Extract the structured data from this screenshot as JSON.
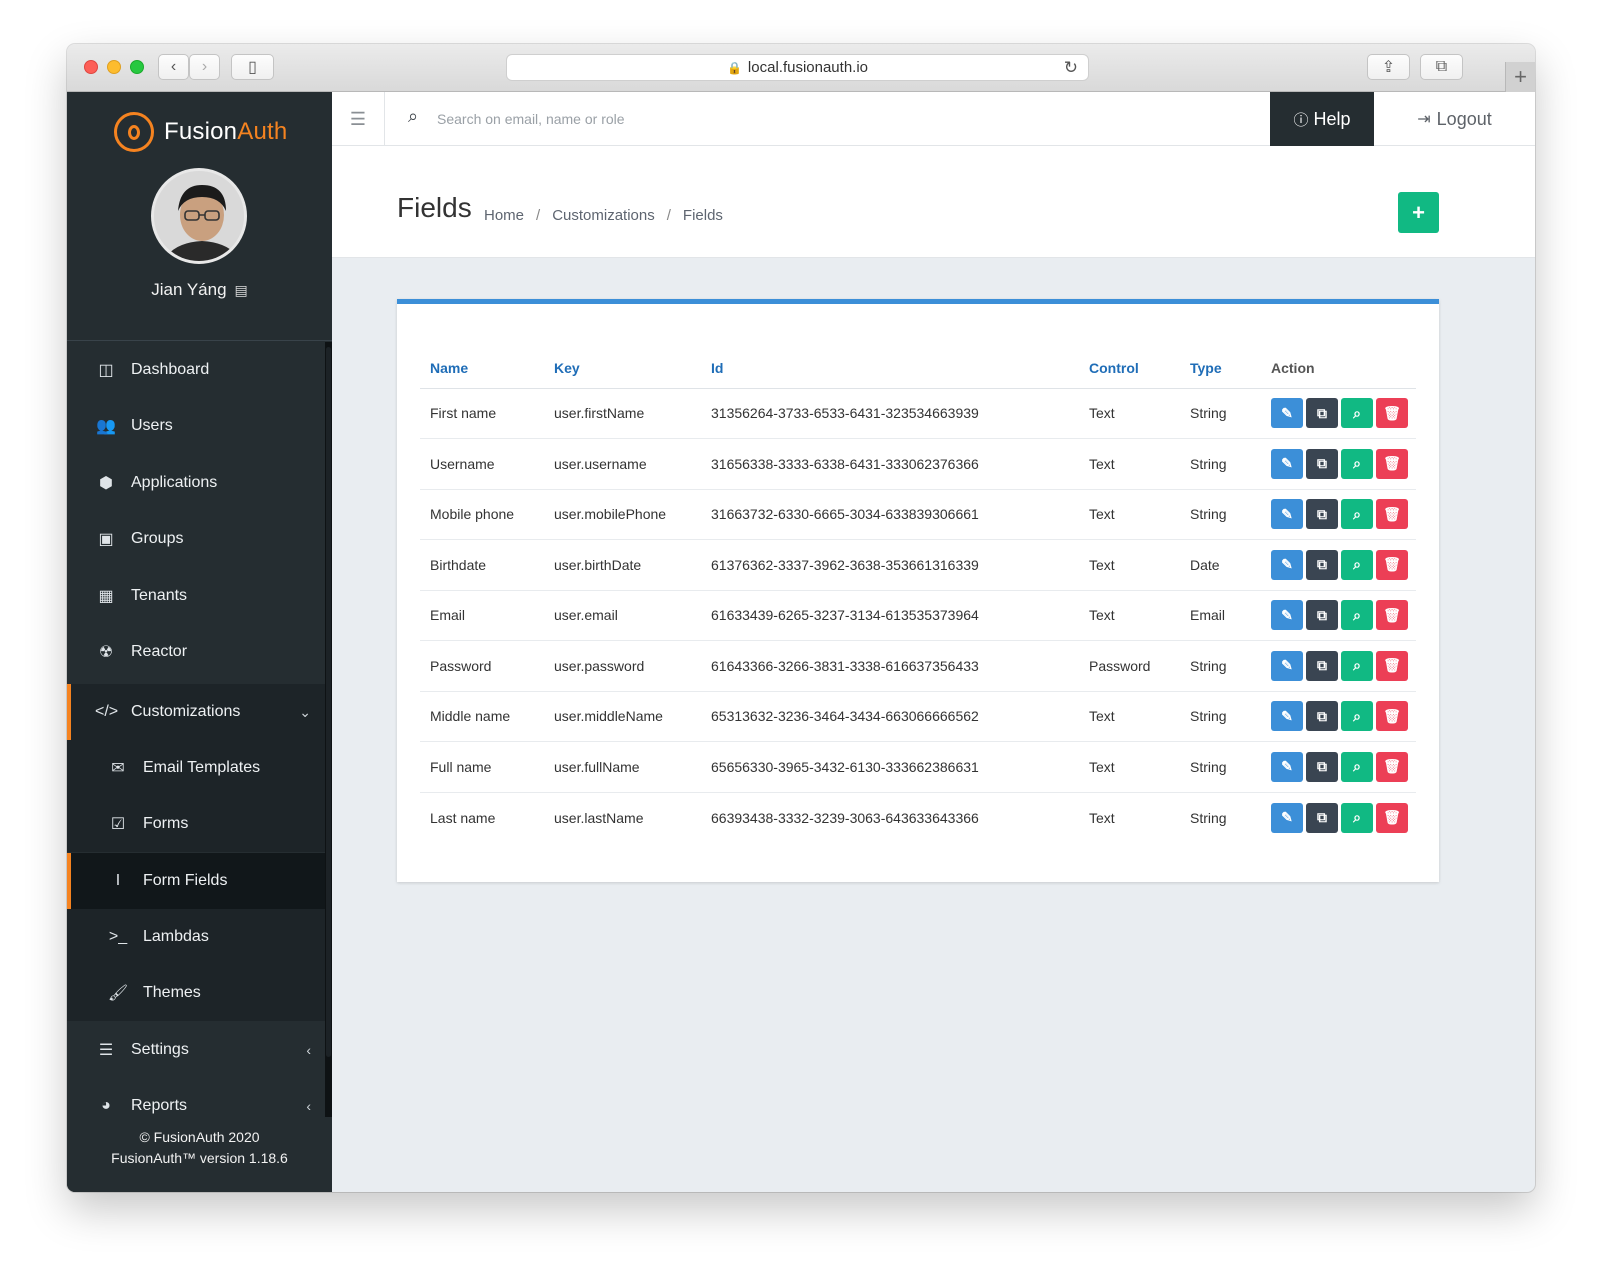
{
  "browser": {
    "url": "local.fusionauth.io"
  },
  "brand": {
    "name_part1": "Fusion",
    "name_part2": "Auth"
  },
  "user": {
    "name": "Jian Yáng"
  },
  "nav": {
    "dashboard": "Dashboard",
    "users": "Users",
    "applications": "Applications",
    "groups": "Groups",
    "tenants": "Tenants",
    "reactor": "Reactor",
    "customizations": "Customizations",
    "email_templates": "Email Templates",
    "forms": "Forms",
    "form_fields": "Form Fields",
    "lambdas": "Lambdas",
    "themes": "Themes",
    "settings": "Settings",
    "reports": "Reports"
  },
  "footer": {
    "copyright": "© FusionAuth 2020",
    "version": "FusionAuth™ version 1.18.6"
  },
  "topbar": {
    "search_placeholder": "Search on email, name or role",
    "help": "Help",
    "logout": "Logout"
  },
  "page": {
    "title": "Fields",
    "breadcrumb": [
      "Home",
      "Customizations",
      "Fields"
    ]
  },
  "table": {
    "columns": [
      "Name",
      "Key",
      "Id",
      "Control",
      "Type",
      "Action"
    ],
    "rows": [
      {
        "name": "First name",
        "key": "user.firstName",
        "id": "31356264-3733-6533-6431-323534663939",
        "control": "Text",
        "type": "String"
      },
      {
        "name": "Username",
        "key": "user.username",
        "id": "31656338-3333-6338-6431-333062376366",
        "control": "Text",
        "type": "String"
      },
      {
        "name": "Mobile phone",
        "key": "user.mobilePhone",
        "id": "31663732-6330-6665-3034-633839306661",
        "control": "Text",
        "type": "String"
      },
      {
        "name": "Birthdate",
        "key": "user.birthDate",
        "id": "61376362-3337-3962-3638-353661316339",
        "control": "Text",
        "type": "Date"
      },
      {
        "name": "Email",
        "key": "user.email",
        "id": "61633439-6265-3237-3134-613535373964",
        "control": "Text",
        "type": "Email"
      },
      {
        "name": "Password",
        "key": "user.password",
        "id": "61643366-3266-3831-3338-616637356433",
        "control": "Password",
        "type": "String"
      },
      {
        "name": "Middle name",
        "key": "user.middleName",
        "id": "65313632-3236-3464-3434-663066666562",
        "control": "Text",
        "type": "String"
      },
      {
        "name": "Full name",
        "key": "user.fullName",
        "id": "65656330-3965-3432-6130-333662386631",
        "control": "Text",
        "type": "String"
      },
      {
        "name": "Last name",
        "key": "user.lastName",
        "id": "66393438-3332-3239-3063-643633643366",
        "control": "Text",
        "type": "String"
      }
    ]
  },
  "colors": {
    "accent": "#f58320",
    "primary": "#3c8fd8",
    "success": "#11b983",
    "danger": "#ec3f56",
    "sidebar": "#252d31"
  }
}
